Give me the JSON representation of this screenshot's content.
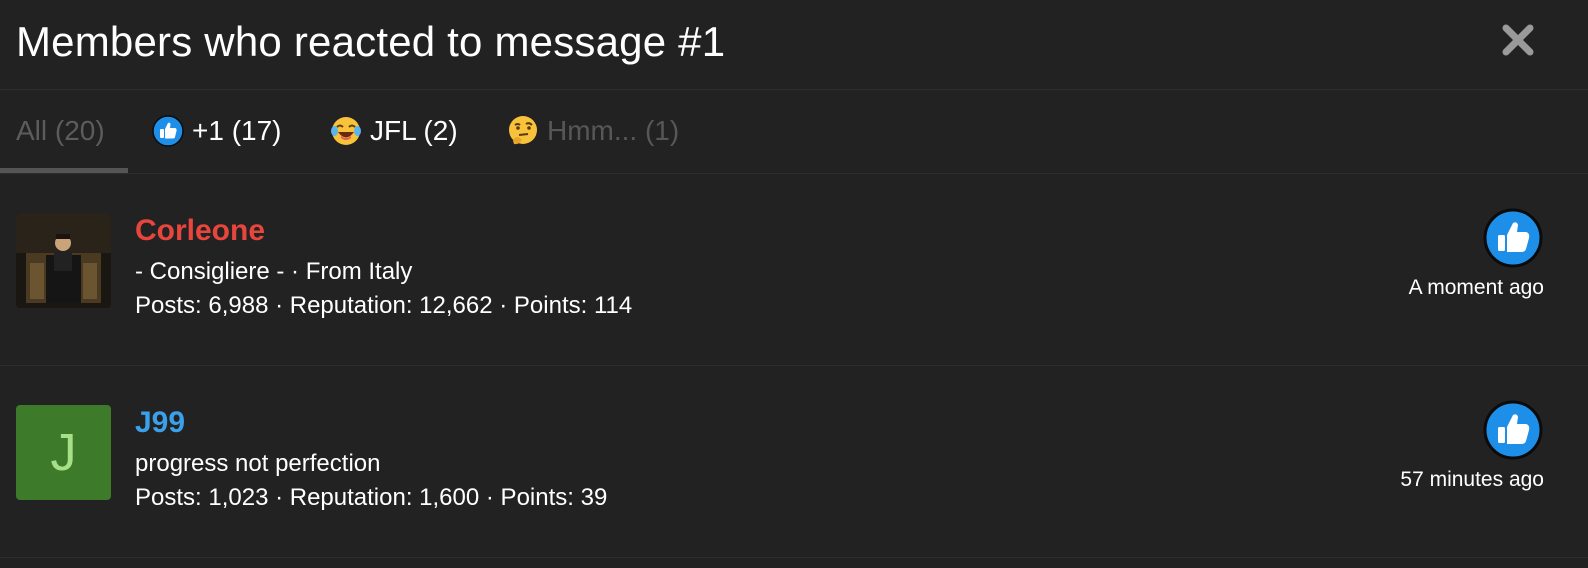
{
  "header": {
    "title": "Members who reacted to message #1"
  },
  "tabs": [
    {
      "label": "All (20)",
      "icon": null,
      "active": true
    },
    {
      "label": "+1 (17)",
      "icon": "thumbs-up-icon"
    },
    {
      "label": "JFL (2)",
      "icon": "laughing-crying-face-icon"
    },
    {
      "label": "Hmm... (1)",
      "icon": "thinking-face-icon"
    }
  ],
  "members": [
    {
      "username": "Corleone",
      "username_color": "#e8453c",
      "title": "- Consigliere - · From Italy",
      "stats": "Posts: 6,988 · Reputation: 12,662 · Points: 114",
      "reaction_icon": "thumbs-up-icon",
      "time": "A moment ago",
      "avatar": "photo"
    },
    {
      "username": "J99",
      "username_color": "#3aa0ea",
      "title": "progress not perfection",
      "stats": "Posts: 1,023 · Reputation: 1,600 · Points: 39",
      "reaction_icon": "thumbs-up-icon",
      "time": "57 minutes ago",
      "avatar": "J"
    }
  ],
  "colors": {
    "background": "#222222",
    "thumbs_up_blue": "#1e8fe8",
    "j_avatar_bg": "#3d7a2a"
  }
}
